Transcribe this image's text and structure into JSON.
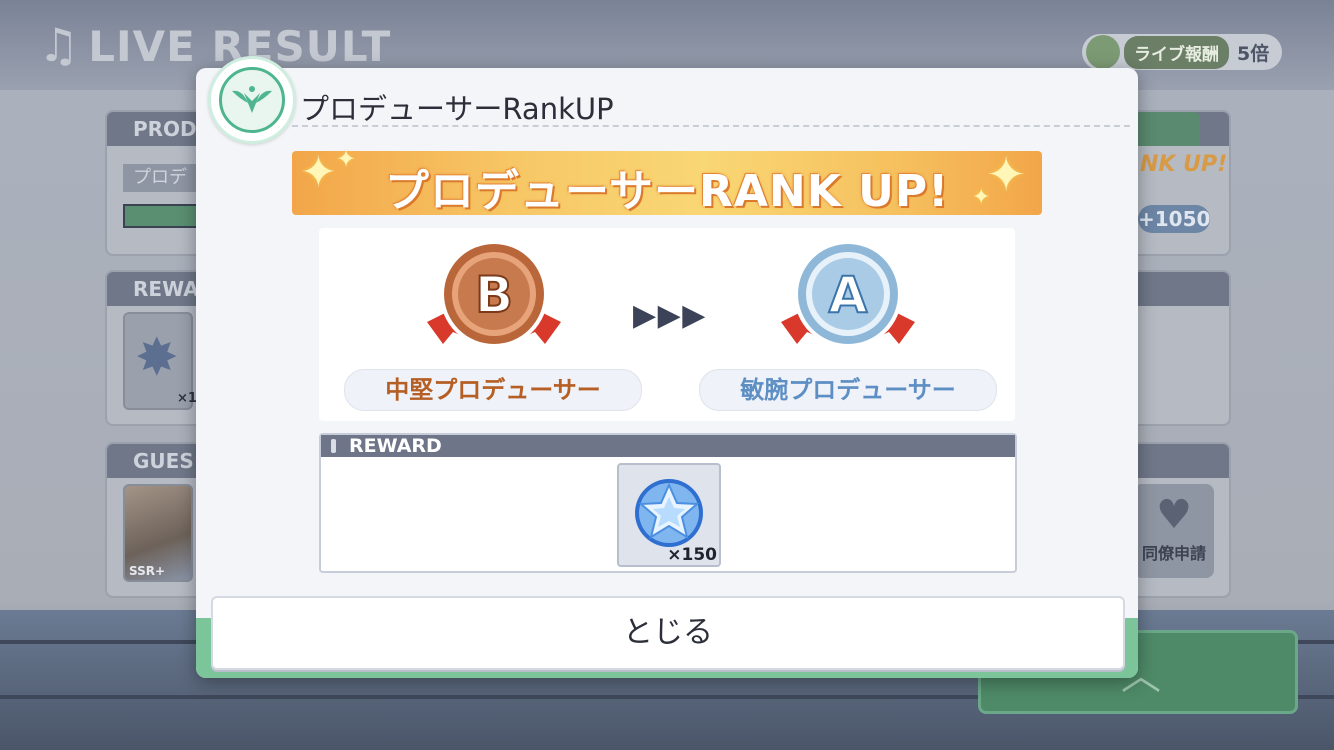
{
  "background": {
    "screen_title": "LIVE RESULT",
    "bonus_label": "ライブ報酬",
    "bonus_multiplier": "5倍",
    "producer_panel_head": "PROD",
    "producer_label": "プロデ",
    "reward_panel_head": "REWA",
    "reward_item_count": "×1",
    "guest_panel_head": "GUES",
    "guest_rarity": "SSR+",
    "rankup_mini": "NK UP!",
    "exp_gain": "+1050",
    "friend_request": "同僚申請"
  },
  "dialog": {
    "title": "プロデューサーRankUP",
    "banner_text": "プロデューサーRANK UP!",
    "old_rank": {
      "letter": "B",
      "name": "中堅プロデューサー"
    },
    "new_rank": {
      "letter": "A",
      "name": "敏腕プロデューサー"
    },
    "reward_header": "REWARD",
    "reward_item": {
      "icon": "star-jewel-icon",
      "count": "×150"
    },
    "close_label": "とじる"
  },
  "colors": {
    "banner_orange": "#f2a649",
    "old_rank_bronze": "#b65f24",
    "new_rank_blue": "#5e8fc4",
    "dialog_green": "#7cc49a"
  }
}
